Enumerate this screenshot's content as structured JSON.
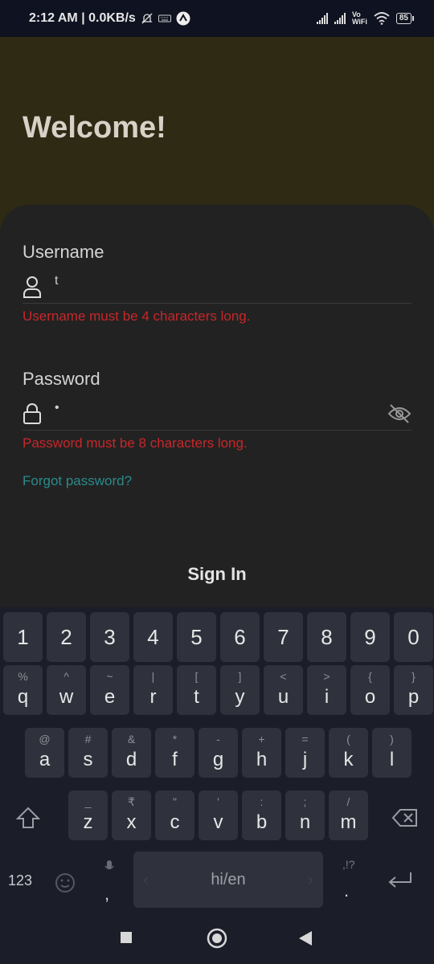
{
  "status_bar": {
    "time_speed": "2:12 AM | 0.0KB/s",
    "vo_wifi_top": "Vo",
    "vo_wifi_bottom": "WiFi",
    "battery": "85"
  },
  "header": {
    "title": "Welcome!",
    "background": "#2f2a14"
  },
  "form": {
    "username_label": "Username",
    "username_value": "t",
    "username_error": "Username must be 4 characters long.",
    "password_label": "Password",
    "password_value": "•",
    "password_error": "Password must be 8 characters long.",
    "forgot_link": "Forgot password?",
    "signin_button": "Sign In",
    "error_color": "#c8272a",
    "link_color": "#2b8a8a"
  },
  "keyboard": {
    "numbers": [
      "1",
      "2",
      "3",
      "4",
      "5",
      "6",
      "7",
      "8",
      "9",
      "0"
    ],
    "row1": {
      "main": [
        "q",
        "w",
        "e",
        "r",
        "t",
        "y",
        "u",
        "i",
        "o",
        "p"
      ],
      "alt": [
        "%",
        "^",
        "~",
        "|",
        "[",
        "]",
        "<",
        ">",
        "{",
        "}"
      ]
    },
    "row2": {
      "main": [
        "a",
        "s",
        "d",
        "f",
        "g",
        "h",
        "j",
        "k",
        "l"
      ],
      "alt": [
        "@",
        "#",
        "&",
        "*",
        "-",
        "+",
        "=",
        "(",
        ")"
      ]
    },
    "row3": {
      "main": [
        "z",
        "x",
        "c",
        "v",
        "b",
        "n",
        "m"
      ],
      "alt": [
        "_",
        "₹",
        "\"",
        "'",
        ":",
        ";",
        "/"
      ]
    },
    "num_switch": "123",
    "comma": ",",
    "space_label": "hi/en",
    "punct_alt": ",!?",
    "period": "."
  }
}
